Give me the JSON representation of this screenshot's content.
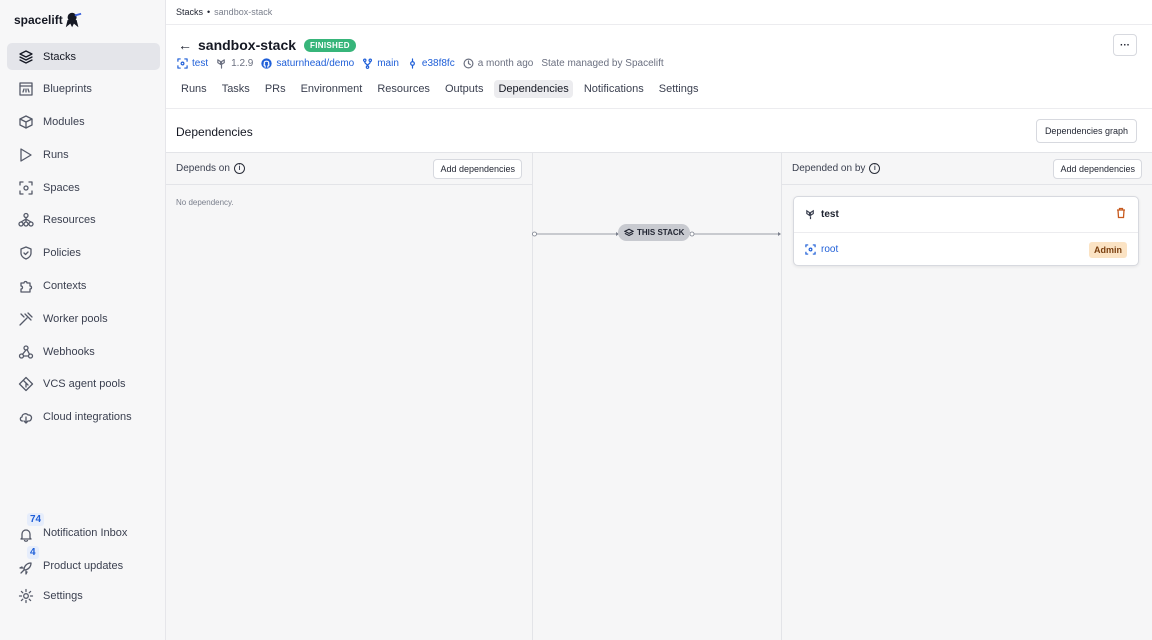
{
  "app": {
    "logo": "spacelift"
  },
  "sidebar": {
    "items": [
      {
        "label": "Stacks",
        "icon": "layers-icon",
        "active": true
      },
      {
        "label": "Blueprints",
        "icon": "blueprint-icon"
      },
      {
        "label": "Modules",
        "icon": "cube-icon"
      },
      {
        "label": "Runs",
        "icon": "play-icon"
      },
      {
        "label": "Spaces",
        "icon": "spaces-icon"
      },
      {
        "label": "Resources",
        "icon": "resources-icon"
      },
      {
        "label": "Policies",
        "icon": "shield-icon"
      },
      {
        "label": "Contexts",
        "icon": "puzzle-icon"
      },
      {
        "label": "Worker pools",
        "icon": "tools-icon"
      },
      {
        "label": "Webhooks",
        "icon": "webhook-icon"
      },
      {
        "label": "VCS agent pools",
        "icon": "vcs-icon"
      },
      {
        "label": "Cloud integrations",
        "icon": "cloud-icon"
      }
    ],
    "notifications": {
      "label": "Notification Inbox",
      "count": "74"
    },
    "updates": {
      "label": "Product updates",
      "count": "4"
    },
    "settings": {
      "label": "Settings"
    }
  },
  "breadcrumb": {
    "root": "Stacks",
    "current": "sandbox-stack"
  },
  "stack": {
    "name": "sandbox-stack",
    "status": "FINISHED",
    "space": "test",
    "version": "1.2.9",
    "repo": "saturnhead/demo",
    "branch": "main",
    "commit": "e38f8fc",
    "updated": "a month ago",
    "state": "State managed by Spacelift"
  },
  "tabs": [
    "Runs",
    "Tasks",
    "PRs",
    "Environment",
    "Resources",
    "Outputs",
    "Dependencies",
    "Notifications",
    "Settings"
  ],
  "active_tab": "Dependencies",
  "section": {
    "title": "Dependencies",
    "graph_button": "Dependencies graph"
  },
  "depends_on": {
    "title": "Depends on",
    "add_button": "Add dependencies",
    "empty": "No dependency."
  },
  "center": {
    "label": "THIS STACK"
  },
  "depended_on_by": {
    "title": "Depended on by",
    "add_button": "Add dependencies",
    "card": {
      "title": "test",
      "space": "root",
      "role": "Admin"
    }
  },
  "colors": {
    "accent": "#1f5fd8",
    "success": "#37b57a",
    "danger": "#c75a1e"
  }
}
